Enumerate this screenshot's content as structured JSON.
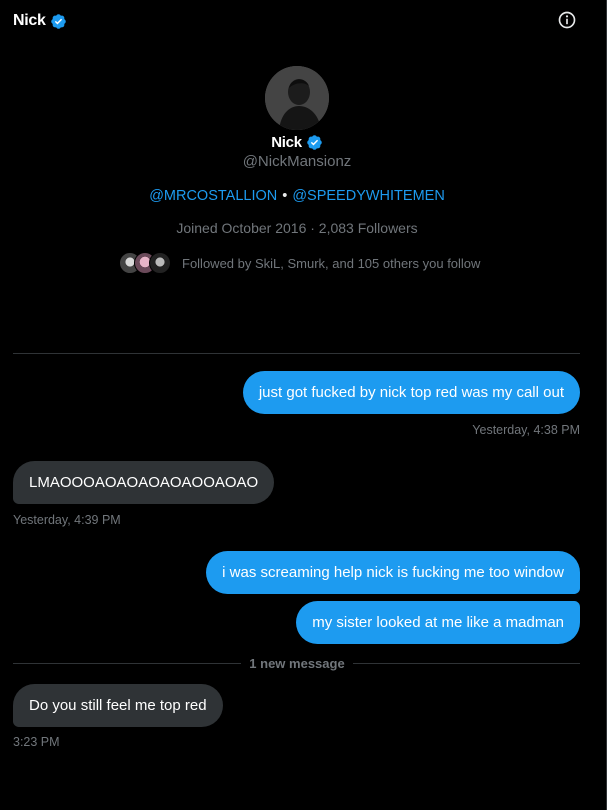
{
  "header": {
    "name": "Nick",
    "info_icon": "info-icon"
  },
  "profile": {
    "name": "Nick",
    "handle": "@NickMansionz",
    "bio_links": [
      "@MRCOSTALLION",
      "@SPEEDYWHITEMEN"
    ],
    "bio_separator": "•",
    "joined": "Joined October 2016 · 2,083 Followers",
    "followed_by": "Followed by SkiL, Smurk, and 105 others you follow"
  },
  "messages": [
    {
      "side": "out",
      "text": "just got fucked by nick top red was my call out",
      "time": "Yesterday, 4:38 PM"
    },
    {
      "side": "in",
      "text": "LMAOOOAOAOAOAOAOOAOAO",
      "time": "Yesterday, 4:39 PM"
    },
    {
      "side": "out",
      "text": "i was screaming help nick is fucking me too window"
    },
    {
      "side": "out",
      "text": "my sister looked at me like a madman"
    },
    {
      "side": "in",
      "text": "Do you still feel me top red",
      "time": "3:23 PM"
    }
  ],
  "new_message_label": "1 new message",
  "colors": {
    "accent": "#1d9bf0",
    "incoming_bubble": "#2f3336",
    "background": "#000000"
  }
}
